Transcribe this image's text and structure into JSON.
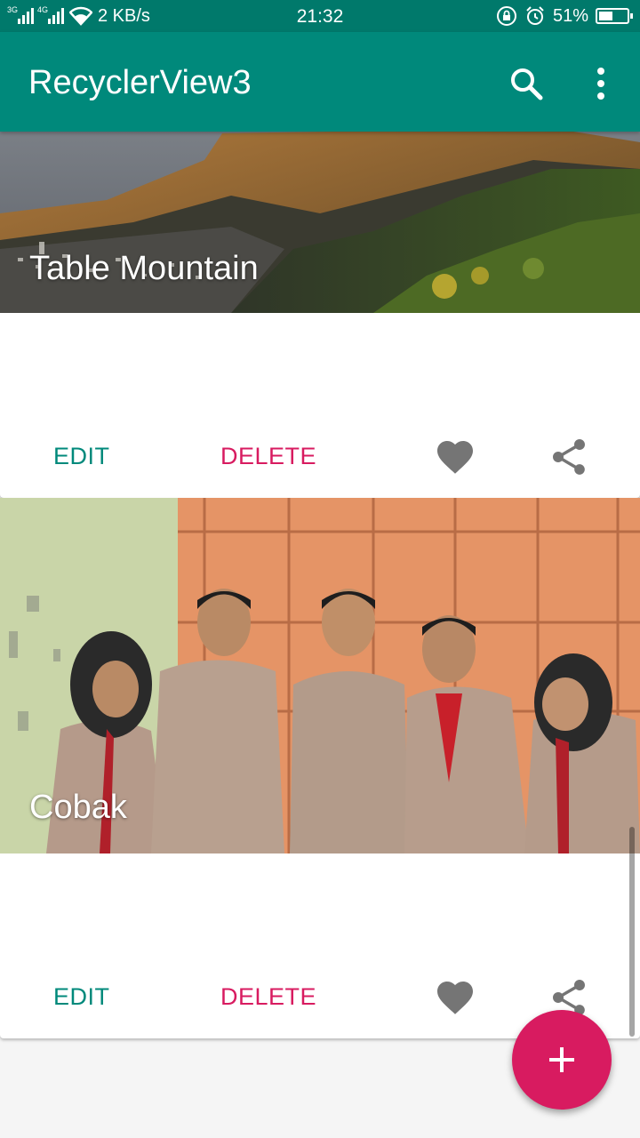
{
  "status_bar": {
    "network_1": "3G",
    "network_2": "4G",
    "data_speed": "2 KB/s",
    "time": "21:32",
    "battery_percent": "51%",
    "battery_level": 0.51,
    "icons": [
      "signal-icon",
      "wifi-icon",
      "lock-rotation-icon",
      "alarm-icon",
      "battery-icon"
    ]
  },
  "app_bar": {
    "title": "RecyclerView3",
    "color": "#00897b",
    "icons": [
      "search-icon",
      "more-vert-icon"
    ]
  },
  "cards": [
    {
      "title": "Table Mountain",
      "edit_label": "EDIT",
      "delete_label": "DELETE",
      "icons": [
        "favorite-icon",
        "share-icon"
      ]
    },
    {
      "title": "Cobak",
      "edit_label": "EDIT",
      "delete_label": "DELETE",
      "icons": [
        "favorite-icon",
        "share-icon"
      ]
    }
  ],
  "fab": {
    "icon": "add-icon",
    "color": "#d81b60"
  },
  "colors": {
    "primary": "#00897b",
    "primary_dark": "#00796b",
    "accent": "#d81b60",
    "icon_gray": "#757575"
  }
}
